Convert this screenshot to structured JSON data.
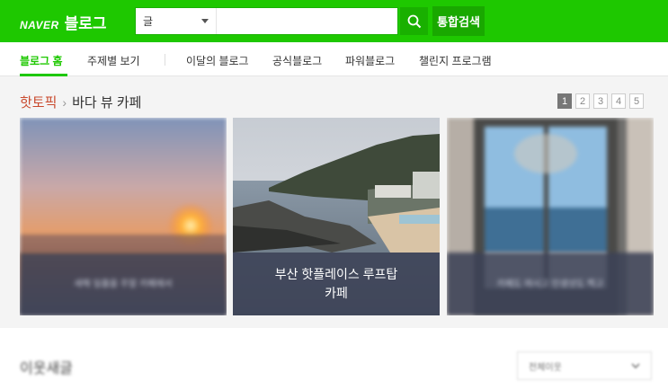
{
  "header": {
    "brand": "NAVER",
    "product": "블로그",
    "search_scope": "글",
    "search_value": "",
    "search_icon": "search-icon",
    "total_search_label": "통합검색",
    "accent_color": "#1ec800"
  },
  "nav": {
    "items": [
      {
        "label": "블로그 홈",
        "active": true
      },
      {
        "label": "주제별 보기"
      },
      {
        "label": "이달의 블로그"
      },
      {
        "label": "공식블로그"
      },
      {
        "label": "파워블로그"
      },
      {
        "label": "챌린지 프로그램"
      }
    ]
  },
  "hot_topic": {
    "label": "핫토픽",
    "topic": "바다 뷰 카페",
    "pages": [
      "1",
      "2",
      "3",
      "4",
      "5"
    ],
    "current_page": "1",
    "cards": [
      {
        "caption": "새해 일출을 주말 카페에서"
      },
      {
        "caption": "부산 핫플레이스 루프탑 카페"
      },
      {
        "caption": "카페도 여시고 인생샷도 찍고"
      }
    ]
  },
  "neighbors": {
    "title": "이웃새글",
    "filter_value": "전체이웃"
  }
}
